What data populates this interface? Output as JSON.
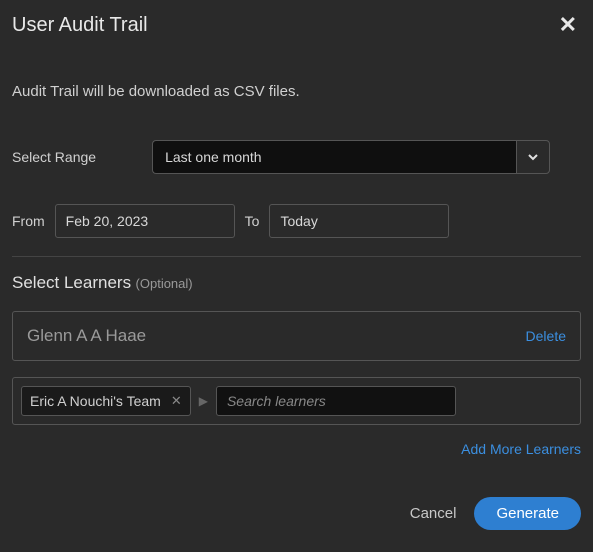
{
  "header": {
    "title": "User Audit Trail"
  },
  "subtitle": "Audit Trail will be downloaded as CSV files.",
  "range": {
    "label": "Select Range",
    "selected": "Last one month"
  },
  "dates": {
    "from_label": "From",
    "from_value": "Feb 20, 2023",
    "to_label": "To",
    "to_value": "Today"
  },
  "learners": {
    "section_title": "Select Learners",
    "optional_text": "(Optional)",
    "selected_name": "Glenn A A Haae",
    "delete_label": "Delete",
    "chip_label": "Eric A Nouchi's Team",
    "search_placeholder": "Search learners",
    "add_more_label": "Add More Learners"
  },
  "footer": {
    "cancel_label": "Cancel",
    "generate_label": "Generate"
  }
}
